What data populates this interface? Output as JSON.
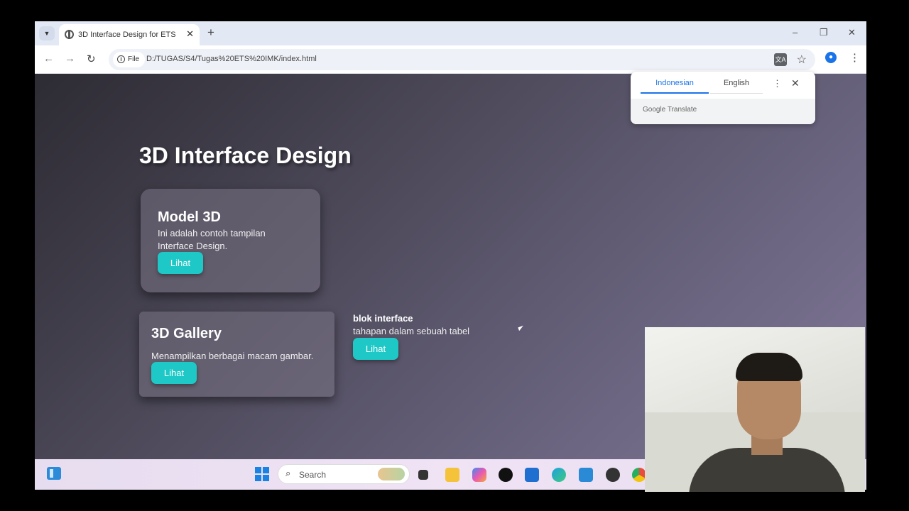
{
  "browser": {
    "tab_title": "3D Interface Design for ETS",
    "close_glyph": "✕",
    "new_tab_glyph": "+",
    "window_controls": {
      "minimize": "–",
      "maximize": "❐",
      "close": "✕"
    },
    "nav": {
      "back": "←",
      "forward": "→",
      "reload": "↻"
    },
    "site_info_label": "File",
    "url": "D:/TUGAS/S4/Tugas%20ETS%20IMK/index.html"
  },
  "translate_popup": {
    "tabs": [
      "Indonesian",
      "English"
    ],
    "active_tab": "Indonesian",
    "brand": "Google Translate"
  },
  "page": {
    "title": "3D Interface Design",
    "cards": [
      {
        "title": "Model 3D",
        "text": "Ini adalah contoh tampilan Interface Design.",
        "button": "Lihat"
      },
      {
        "title": "3D Gallery",
        "text": "Menampilkan berbagai macam gambar.",
        "button": "Lihat"
      }
    ],
    "block": {
      "title": "blok interface",
      "text": "tahapan dalam sebuah tabel",
      "button": "Lihat"
    },
    "accent_color": "#1ec8c6"
  },
  "taskbar": {
    "search_placeholder": "Search",
    "apps": [
      "file-explorer-icon",
      "copilot-icon",
      "tiktok-icon",
      "store-icon",
      "edge-icon",
      "vscode-icon",
      "davinci-icon",
      "chrome-icon"
    ]
  }
}
